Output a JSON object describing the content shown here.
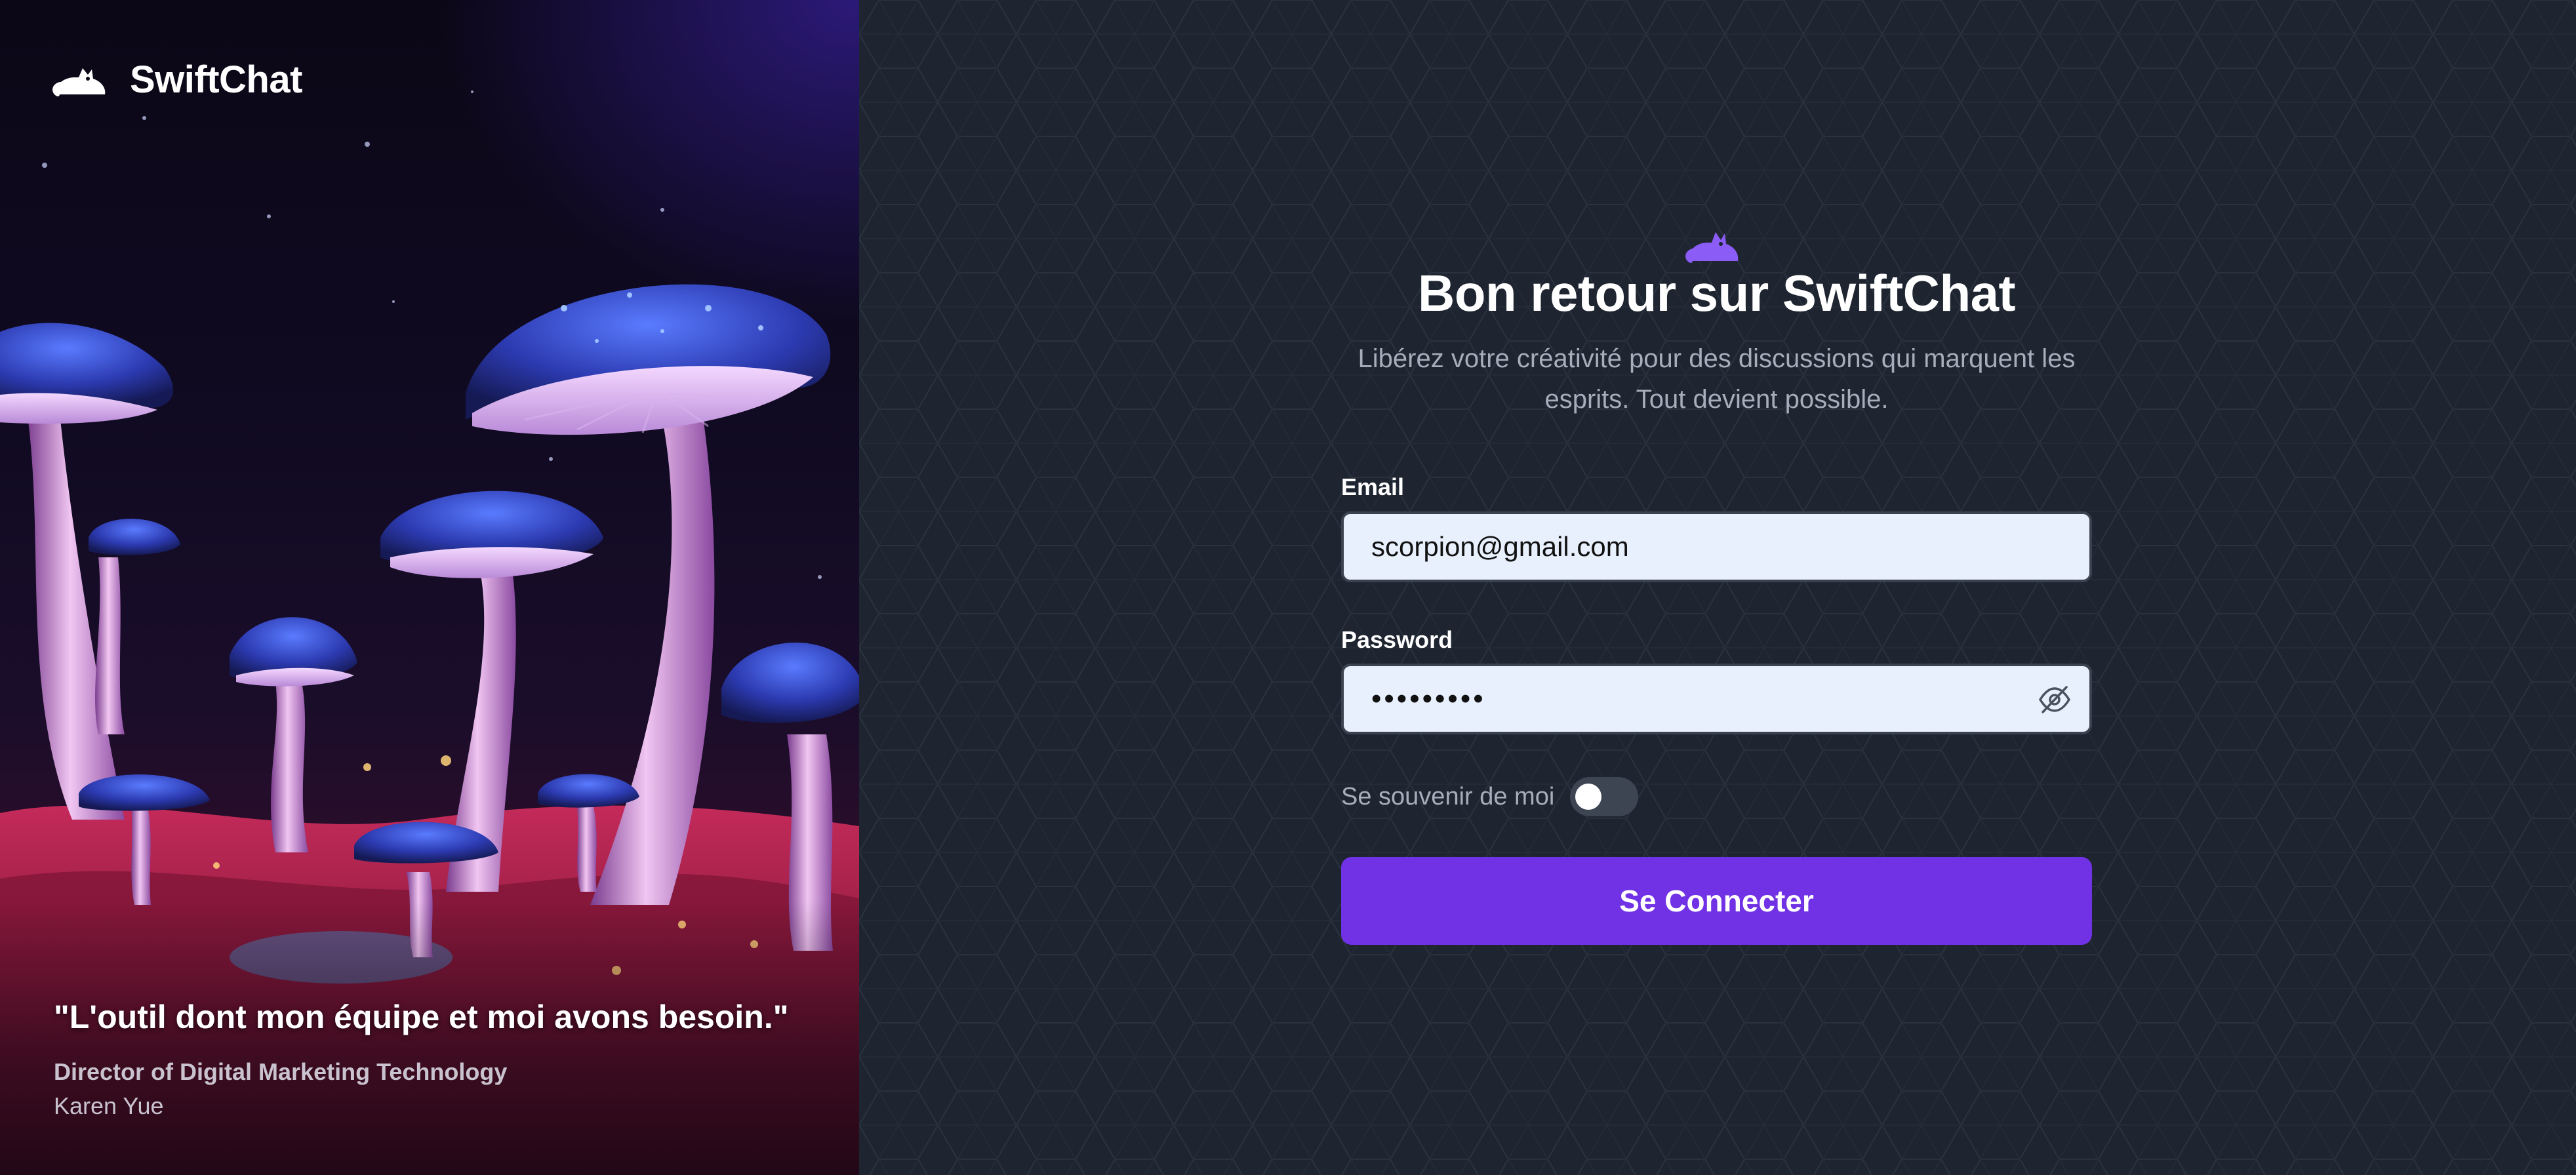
{
  "brand": {
    "name": "SwiftChat",
    "logo_icon": "cat-logo-icon"
  },
  "testimonial": {
    "quote": "\"L'outil dont mon équipe et moi avons besoin.\"",
    "role": "Director of Digital Marketing Technology",
    "author": "Karen Yue"
  },
  "login": {
    "title": "Bon retour sur SwiftChat",
    "subtitle_line1": "Libérez votre créativité pour des discussions qui marquent les",
    "subtitle_line2": "esprits. Tout devient possible.",
    "email_label": "Email",
    "email_value": "scorpion@gmail.com",
    "password_label": "Password",
    "password_value": "•••••••••",
    "password_toggle_icon": "eye-off-icon",
    "remember_label": "Se souvenir de moi",
    "remember_checked": false,
    "submit_label": "Se Connecter"
  },
  "colors": {
    "accent": "#7132e6",
    "panel_background": "#1e2530",
    "input_background": "#e8f0fd",
    "logo_purple": "#8b5cf6"
  }
}
